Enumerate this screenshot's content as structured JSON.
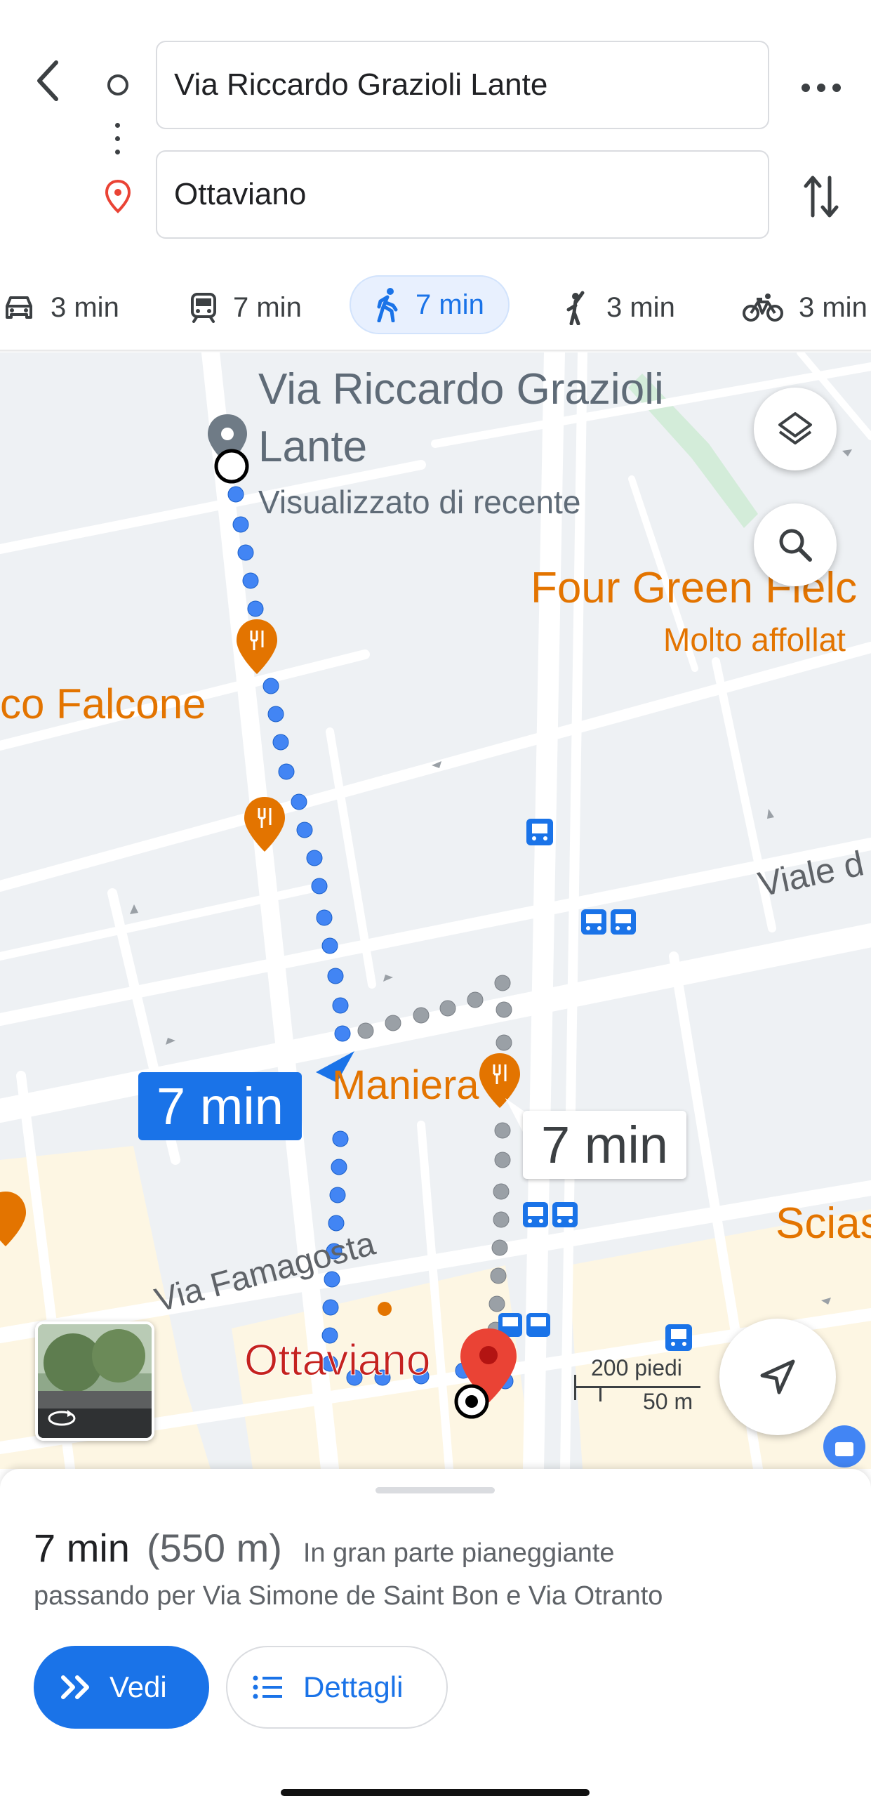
{
  "header": {
    "origin": "Via Riccardo Grazioli Lante",
    "destination": "Ottaviano",
    "modes": [
      {
        "icon": "car-icon",
        "label": "3 min",
        "active": false
      },
      {
        "icon": "transit-icon",
        "label": "7 min",
        "active": false
      },
      {
        "icon": "walk-icon",
        "label": "7 min",
        "active": true
      },
      {
        "icon": "ride-hail-icon",
        "label": "3 min",
        "active": false
      },
      {
        "icon": "bike-icon",
        "label": "3 min",
        "active": false
      }
    ]
  },
  "map": {
    "origin_title": "Via Riccardo Grazioli Lante",
    "origin_title_line1": "Via Riccardo Grazioli",
    "origin_title_line2": "Lante",
    "origin_subtitle": "Visualizzato di recente",
    "place_four_green": "Four Green Fielc",
    "place_four_green_note": "Molto affollat",
    "place_falcone": "co Falcone",
    "place_maniera": "Dolce Maniera",
    "place_maniera_visible": "Maniera",
    "place_scias": "Scias",
    "street_viale": "Viale d",
    "street_famagosta": "Via Famagosta",
    "destination_label": "Ottaviano",
    "route_time_primary": "7 min",
    "route_time_alt": "7 min",
    "scale_imperial": "200 piedi",
    "scale_metric": "50 m",
    "colors": {
      "route": "#4285f4",
      "alt_route": "#9aa0a6",
      "poi": "#e37400",
      "dest_pin": "#ea4335"
    }
  },
  "sheet": {
    "time": "7 min",
    "distance": "(550 m)",
    "terrain": "In gran parte pianeggiante",
    "via": "passando per Via Simone de Saint Bon e Via Otranto",
    "primary_button": "Vedi",
    "secondary_button": "Dettagli"
  }
}
